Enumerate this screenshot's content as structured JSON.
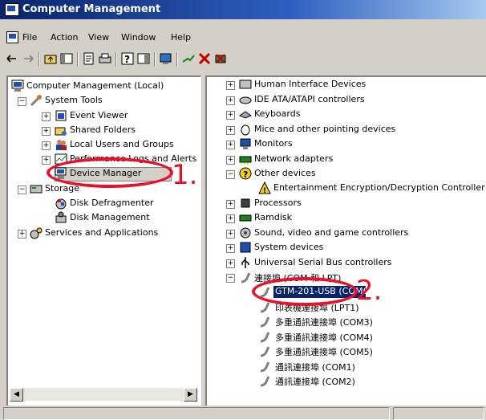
{
  "window": {
    "title": "Computer Management"
  },
  "menu": {
    "items": [
      "File",
      "Action",
      "View",
      "Window",
      "Help"
    ]
  },
  "toolbar": {
    "buttons": [
      "back-icon",
      "forward-icon",
      "up-folder-icon",
      "show-tree-icon",
      "properties-icon",
      "print-icon",
      "help-icon",
      "console-icon",
      "scan-hardware-icon",
      "disable-icon",
      "uninstall-icon",
      "update-driver-icon"
    ]
  },
  "left_tree": {
    "root": "Computer Management (Local)",
    "system_tools": "System Tools",
    "event_viewer": "Event Viewer",
    "shared_folders": "Shared Folders",
    "local_users": "Local Users and Groups",
    "performance": "Performance Logs and Alerts",
    "device_manager": "Device Manager",
    "storage": "Storage",
    "disk_defrag": "Disk Defragmenter",
    "disk_mgmt": "Disk Management",
    "services": "Services and Applications"
  },
  "right_tree": {
    "items": [
      "Human Interface Devices",
      "IDE ATA/ATAPI controllers",
      "Keyboards",
      "Mice and other pointing devices",
      "Monitors",
      "Network adapters",
      "Other devices",
      "Entertainment Encryption/Decryption Controller",
      "Processors",
      "Ramdisk",
      "Sound, video and game controllers",
      "System devices",
      "Universal Serial Bus controllers",
      "連接埠 (COM 和 LPT)",
      "GTM-201-USB (COM6)",
      "印表機連接埠 (LPT1)",
      "多重通訊連接埠 (COM3)",
      "多重通訊連接埠 (COM4)",
      "多重通訊連接埠 (COM5)",
      "通訊連接埠 (COM1)",
      "通訊連接埠 (COM2)"
    ]
  },
  "annotations": {
    "step1": "1.",
    "step2": "2."
  },
  "colors": {
    "title_bar": "#0a246a",
    "callout": "#e8102a",
    "selection": "#0a246a"
  }
}
